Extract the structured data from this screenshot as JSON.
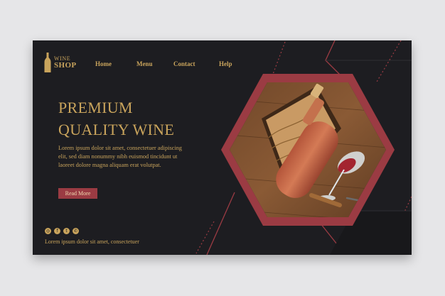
{
  "logo": {
    "line1": "WINE",
    "line2": "SHOP",
    "icon": "wine-bottle-icon"
  },
  "nav": {
    "items": [
      "Home",
      "Menu",
      "Contact",
      "Help"
    ]
  },
  "hero": {
    "title_line1": "PREMIUM",
    "title_line2": "QUALITY WINE",
    "body": "Lorem ipsum dolor sit amet, consectetuer adipiscing elit, sed diam nonummy nibh euismod tincidunt ut laoreet dolore magna aliquam erat volutpat.",
    "cta": "Read More"
  },
  "social": {
    "icons": [
      "instagram-icon",
      "facebook-icon",
      "twitter-icon",
      "whatsapp-icon"
    ],
    "glyphs": [
      "◎",
      "f",
      "t",
      "✆"
    ]
  },
  "footer": {
    "text": "Lorem ipsum dolor sit amet, consectetuer"
  },
  "colors": {
    "background": "#1d1d21",
    "gold": "#c9a45c",
    "accent_red": "#9b3b43",
    "page": "#e6e6e8"
  }
}
